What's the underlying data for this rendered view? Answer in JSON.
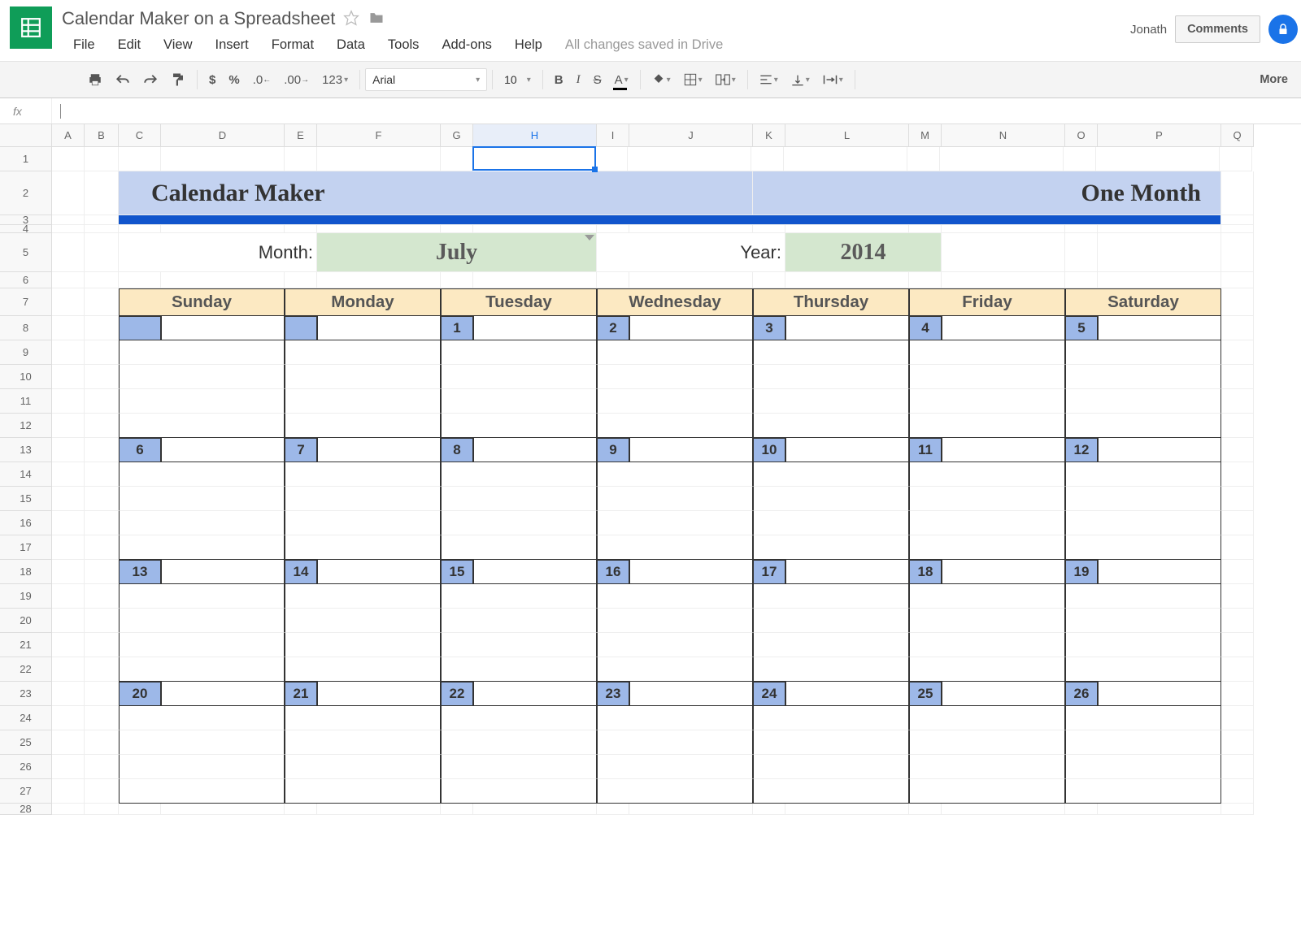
{
  "doc": {
    "title": "Calendar Maker on a Spreadsheet"
  },
  "user": {
    "name": "Jonath"
  },
  "menus": [
    "File",
    "Edit",
    "View",
    "Insert",
    "Format",
    "Data",
    "Tools",
    "Add-ons",
    "Help"
  ],
  "save_status": "All changes saved in Drive",
  "buttons": {
    "comments": "Comments"
  },
  "toolbar": {
    "font": "Arial",
    "size": "10",
    "number_format": "123",
    "decimal_less": ".0",
    "decimal_more": ".00",
    "dollar": "$",
    "percent": "%",
    "bold": "B",
    "italic": "I",
    "strike": "S",
    "textcolor": "A",
    "more": "More"
  },
  "formula_label": "fx",
  "columns": [
    "A",
    "B",
    "C",
    "D",
    "E",
    "F",
    "G",
    "H",
    "I",
    "J",
    "K",
    "L",
    "M",
    "N",
    "O",
    "P",
    "Q"
  ],
  "cal": {
    "title_left": "Calendar Maker",
    "title_right": "One Month",
    "month_label": "Month:",
    "month_value": "July",
    "year_label": "Year:",
    "year_value": "2014",
    "dow": [
      "Sunday",
      "Monday",
      "Tuesday",
      "Wednesday",
      "Thursday",
      "Friday",
      "Saturday"
    ],
    "weeks": [
      [
        "",
        "",
        "1",
        "2",
        "3",
        "4",
        "5"
      ],
      [
        "6",
        "7",
        "8",
        "9",
        "10",
        "11",
        "12"
      ],
      [
        "13",
        "14",
        "15",
        "16",
        "17",
        "18",
        "19"
      ],
      [
        "20",
        "21",
        "22",
        "23",
        "24",
        "25",
        "26"
      ]
    ]
  },
  "row_heights": {
    "r1": 30,
    "r2": 54,
    "r3": 10,
    "r4": 8,
    "r5": 48,
    "r6": 20,
    "r7": 34,
    "rdate": 30,
    "rplain": 30
  },
  "selected_col": "H"
}
